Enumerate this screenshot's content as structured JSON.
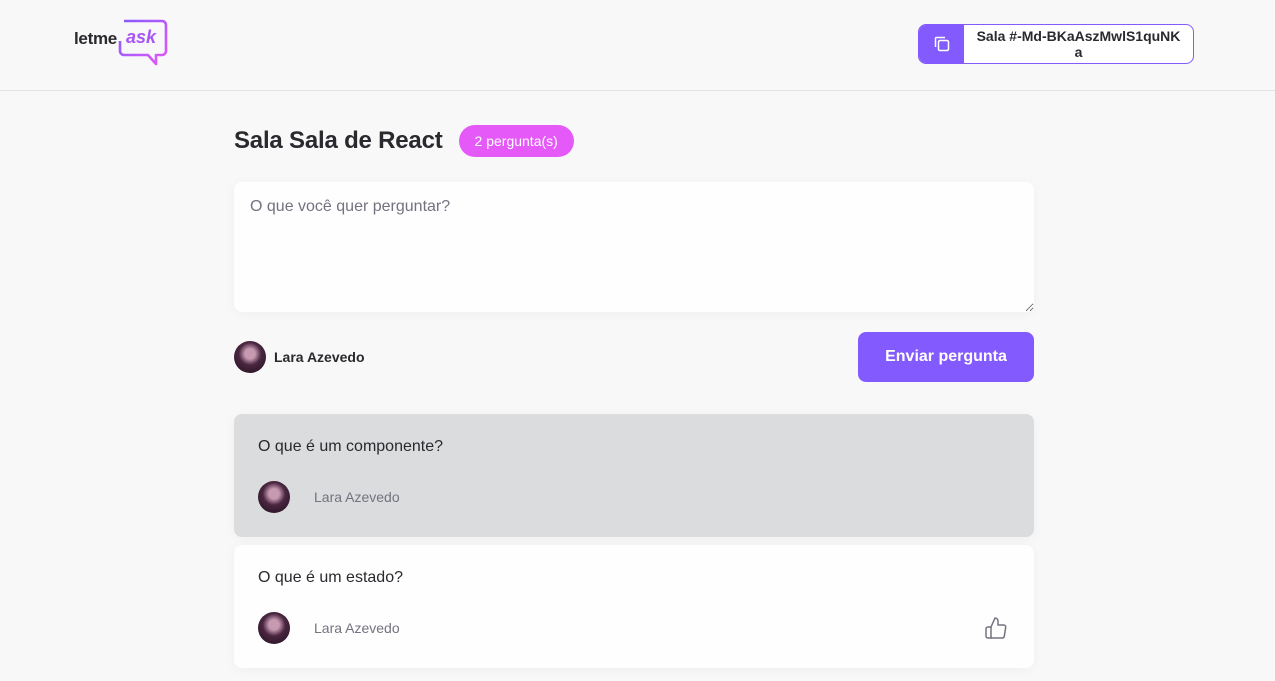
{
  "header": {
    "logo_letme": "letme",
    "logo_ask": "ask",
    "room_code": "Sala #-Md-BKaAszMwlS1quNKa"
  },
  "room": {
    "title": "Sala Sala de React",
    "question_count": "2 pergunta(s)"
  },
  "form": {
    "placeholder": "O que você quer perguntar?",
    "value": "",
    "user_name": "Lara Azevedo",
    "send_label": "Enviar pergunta"
  },
  "questions": [
    {
      "content": "O que é um componente?",
      "author": "Lara Azevedo",
      "highlighted": true
    },
    {
      "content": "O que é um estado?",
      "author": "Lara Azevedo",
      "highlighted": false
    }
  ],
  "icons": {
    "copy": "copy-icon",
    "like": "thumbs-up-icon",
    "logo": "chat-bubble-icon"
  },
  "colors": {
    "brand": "#835afd",
    "badge": "#e559f9",
    "highlighted_card": "#dbdcdd",
    "background": "#f8f8f8"
  }
}
